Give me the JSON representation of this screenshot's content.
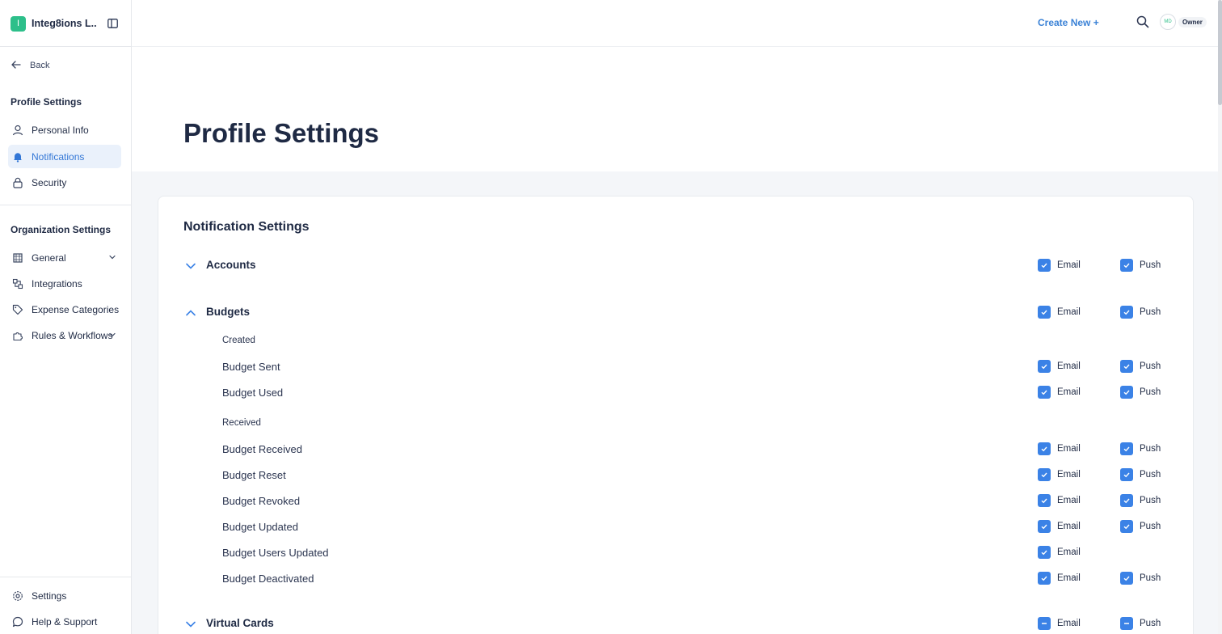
{
  "org": {
    "badge": "I",
    "name": "Integ8ions L..."
  },
  "sidebar": {
    "back_label": "Back",
    "profile_section": "Profile Settings",
    "profile_items": [
      {
        "label": "Personal Info",
        "icon": "user-icon"
      },
      {
        "label": "Notifications",
        "icon": "bell-icon",
        "active": true
      },
      {
        "label": "Security",
        "icon": "lock-icon"
      }
    ],
    "org_section": "Organization Settings",
    "org_items": [
      {
        "label": "General",
        "icon": "building-icon",
        "expandable": true
      },
      {
        "label": "Integrations",
        "icon": "integrations-icon"
      },
      {
        "label": "Expense Categories",
        "icon": "tag-icon"
      },
      {
        "label": "Rules & Workflows",
        "icon": "puzzle-icon",
        "expandable": true
      }
    ],
    "footer_items": [
      {
        "label": "Settings",
        "icon": "gear-icon"
      },
      {
        "label": "Help & Support",
        "icon": "chat-icon"
      }
    ]
  },
  "header": {
    "create_new": "Create New +",
    "avatar_initials": "MD",
    "role": "Owner"
  },
  "page": {
    "title": "Profile Settings",
    "card_title": "Notification Settings",
    "email_label": "Email",
    "push_label": "Push"
  },
  "notifications": {
    "accounts": {
      "label": "Accounts",
      "expanded": false,
      "email": "checked",
      "push": "checked"
    },
    "budgets": {
      "label": "Budgets",
      "expanded": true,
      "email": "checked",
      "push": "checked"
    },
    "created_label": "Created",
    "created_items": [
      {
        "label": "Budget Sent",
        "email": "checked",
        "push": "checked"
      },
      {
        "label": "Budget Used",
        "email": "checked",
        "push": "checked"
      }
    ],
    "received_label": "Received",
    "received_items": [
      {
        "label": "Budget Received",
        "email": "checked",
        "push": "checked"
      },
      {
        "label": "Budget Reset",
        "email": "checked",
        "push": "checked"
      },
      {
        "label": "Budget Revoked",
        "email": "checked",
        "push": "checked"
      },
      {
        "label": "Budget Updated",
        "email": "checked",
        "push": "checked"
      },
      {
        "label": "Budget Users Updated",
        "email": "checked",
        "push": "none"
      },
      {
        "label": "Budget Deactivated",
        "email": "checked",
        "push": "checked"
      }
    ],
    "virtual_cards": {
      "label": "Virtual Cards",
      "expanded": false,
      "email": "indeterminate",
      "push": "indeterminate"
    }
  },
  "colors": {
    "accent": "#3b82e6",
    "brand": "#2dbf8a",
    "active_bg": "#eaf1fb"
  }
}
